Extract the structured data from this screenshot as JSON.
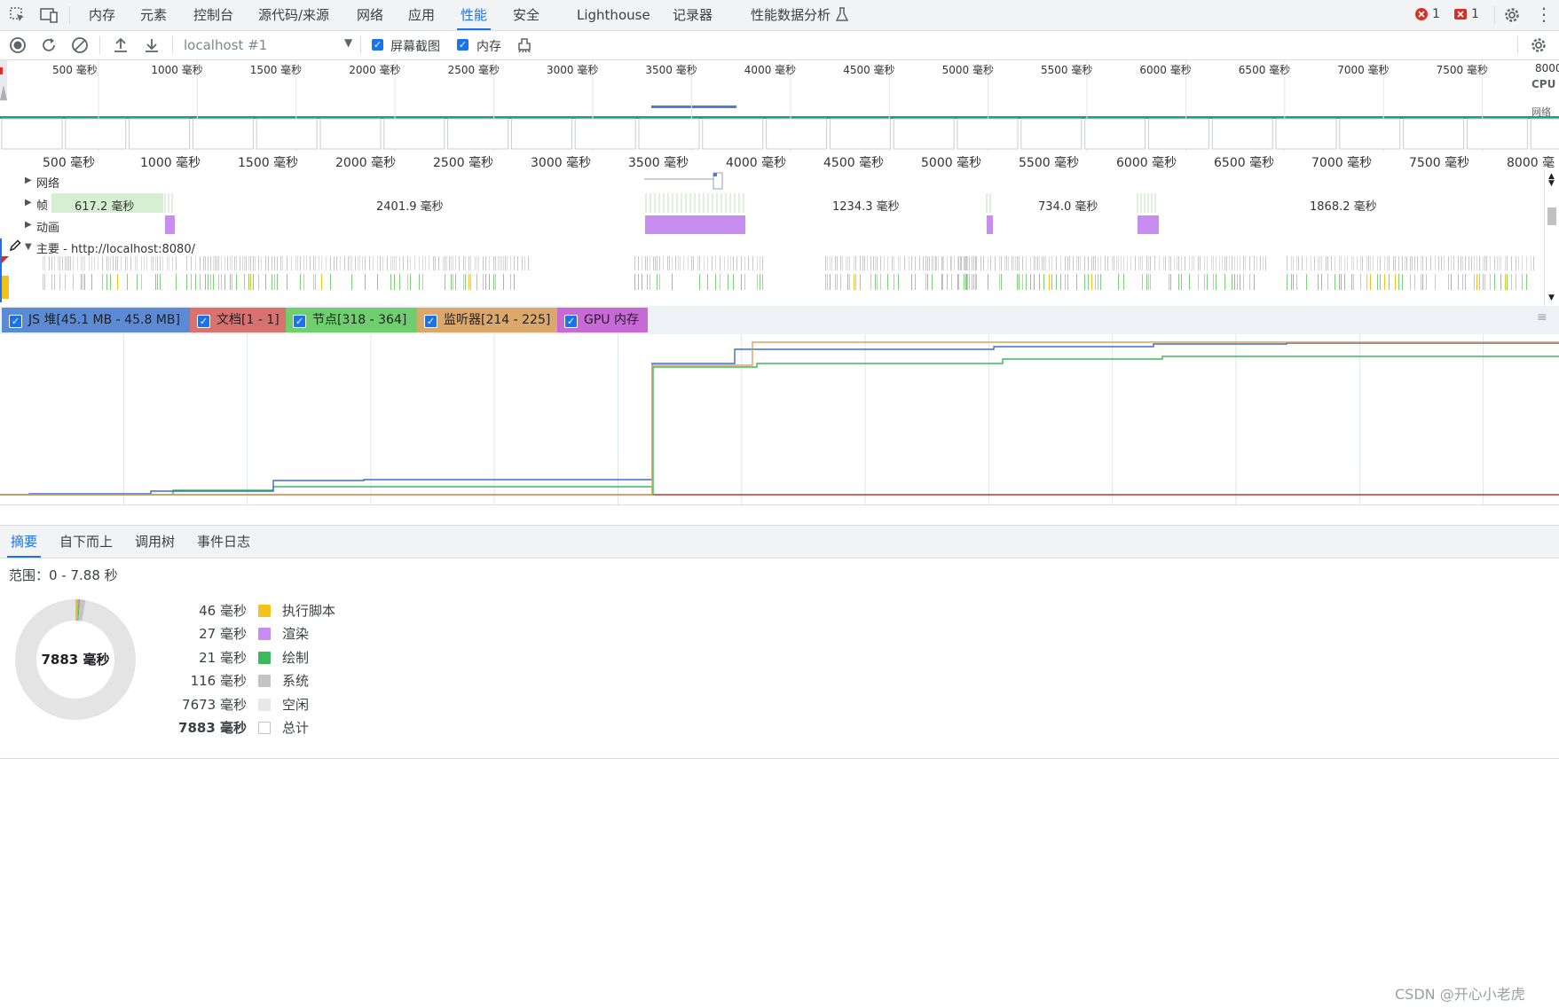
{
  "tabs": [
    "内存",
    "元素",
    "控制台",
    "源代码/来源",
    "网络",
    "应用",
    "性能",
    "安全",
    "Lighthouse",
    "记录器",
    "性能数据分析"
  ],
  "badges": {
    "errors": "1",
    "issues": "1"
  },
  "toolbar": {
    "target": "localhost #1",
    "screenshots_label": "屏幕截图",
    "memory_label": "内存"
  },
  "overview": {
    "ticks": [
      "500 毫秒",
      "1000 毫秒",
      "1500 毫秒",
      "2000 毫秒",
      "2500 毫秒",
      "3000 毫秒",
      "3500 毫秒",
      "4000 毫秒",
      "4500 毫秒",
      "5000 毫秒",
      "5500 毫秒",
      "6000 毫秒",
      "6500 毫秒",
      "7000 毫秒",
      "7500 毫秒",
      "8000"
    ],
    "cpu_label": "CPU",
    "net_label": "网络"
  },
  "ruler_ticks": [
    "500 毫秒",
    "1000 毫秒",
    "1500 毫秒",
    "2000 毫秒",
    "2500 毫秒",
    "3000 毫秒",
    "3500 毫秒",
    "4000 毫秒",
    "4500 毫秒",
    "5000 毫秒",
    "5500 毫秒",
    "6000 毫秒",
    "6500 毫秒",
    "7000 毫秒",
    "7500 毫秒",
    "8000 毫"
  ],
  "tracks": {
    "network": "网络",
    "frames": "帧",
    "frame_durations": [
      "617.2 毫秒",
      "2401.9 毫秒",
      "1234.3 毫秒",
      "734.0 毫秒",
      "1868.2 毫秒"
    ],
    "animation": "动画",
    "main": "主要 - http://localhost:8080/"
  },
  "memory_legend": [
    {
      "label": "JS 堆[45.1 MB - 45.8 MB]",
      "color": "#5b8bd4"
    },
    {
      "label": "文档[1 - 1]",
      "color": "#d9716f"
    },
    {
      "label": "节点[318 - 364]",
      "color": "#6fcf6f"
    },
    {
      "label": "监听器[214 - 225]",
      "color": "#d9a86a"
    },
    {
      "label": "GPU 内存",
      "color": "#c86ad6"
    }
  ],
  "bottom_tabs": [
    "摘要",
    "自下而上",
    "调用树",
    "事件日志"
  ],
  "summary": {
    "range": "范围：0 - 7.88 秒",
    "total_center": "7883 毫秒",
    "rows": [
      {
        "value": "46 毫秒",
        "label": "执行脚本",
        "color": "#f5c21b"
      },
      {
        "value": "27 毫秒",
        "label": "渲染",
        "color": "#c78df0"
      },
      {
        "value": "21 毫秒",
        "label": "绘制",
        "color": "#3cb95c"
      },
      {
        "value": "116 毫秒",
        "label": "系统",
        "color": "#c4c4c4"
      },
      {
        "value": "7673 毫秒",
        "label": "空闲",
        "color": "#e8e8e8"
      },
      {
        "value": "7883 毫秒",
        "label": "总计",
        "color": "#ffffff"
      }
    ]
  },
  "watermark": "CSDN @开心小老虎"
}
